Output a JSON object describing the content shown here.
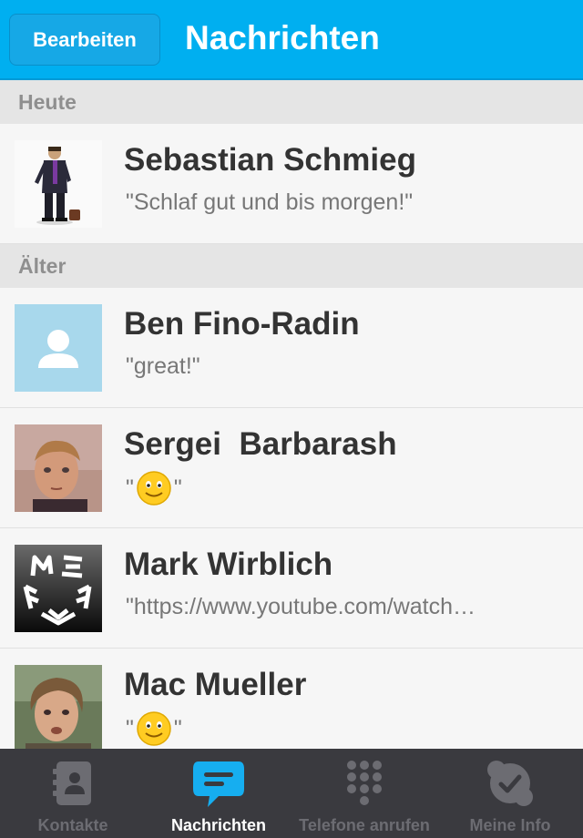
{
  "header": {
    "edit_label": "Bearbeiten",
    "title": "Nachrichten"
  },
  "sections": {
    "today": "Heute",
    "older": "Älter"
  },
  "conversations": [
    {
      "name": "Sebastian Schmieg",
      "message": "\"Schlaf gut und bis morgen!\""
    },
    {
      "name": "Ben Fino-Radin",
      "message": "\"great!\""
    },
    {
      "name": "Sergei  Barbarash",
      "message_prefix": "\"",
      "message_suffix": "\""
    },
    {
      "name": "Mark Wirblich",
      "message": "\"https://www.youtube.com/watch…"
    },
    {
      "name": "Mac Mueller",
      "message_prefix": "\"",
      "message_suffix": "\""
    }
  ],
  "tabs": [
    {
      "label": "Kontakte",
      "icon": "contacts-icon"
    },
    {
      "label": "Nachrichten",
      "icon": "chat-bubble-icon",
      "active": true
    },
    {
      "label": "Telefone anrufen",
      "icon": "dialpad-icon"
    },
    {
      "label": "Meine Info",
      "icon": "skype-check-icon"
    }
  ],
  "colors": {
    "accent": "#00aff0",
    "tab_bar": "#3a3a3f",
    "tab_active_icon": "#16aef0"
  }
}
